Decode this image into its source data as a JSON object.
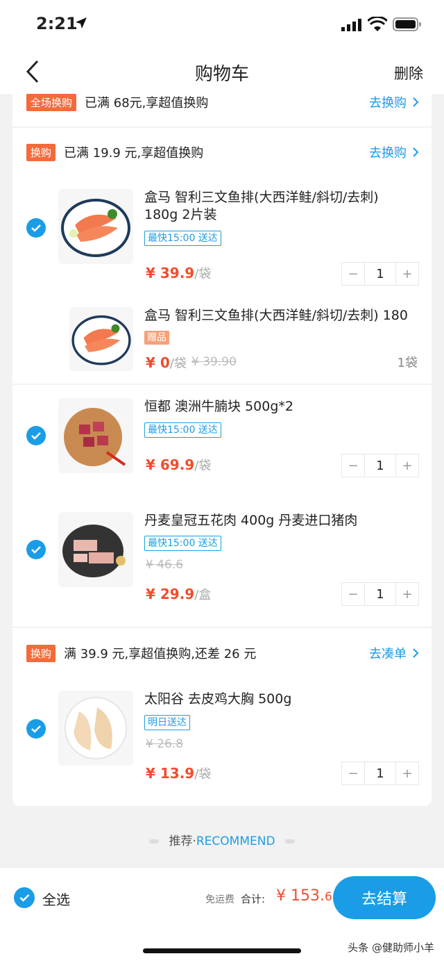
{
  "status": {
    "time": "2:21"
  },
  "nav": {
    "title": "购物车",
    "delete_label": "删除"
  },
  "promo_top": {
    "tag": "全场换购",
    "text": "已满 68元,享超值换购",
    "link": "去换购"
  },
  "group1": {
    "tag": "换购",
    "text": "已满 19.9 元,享超值换购",
    "link": "去换购"
  },
  "items": [
    {
      "name": "盒马 智利三文鱼排(大西洋鲑/斜切/去刺) 180g 2片装",
      "delivery": "最快15:00 送达",
      "price": "¥ 39.9",
      "unit": "/袋",
      "qty": "1"
    },
    {
      "name": "盒马 智利三文鱼排(大西洋鲑/斜切/去刺) 180",
      "gift": "赠品",
      "price": "¥ 0",
      "unit": "/袋",
      "old_price": "¥ 39.90",
      "qty_text": "1袋"
    },
    {
      "name": "恒都 澳洲牛腩块 500g*2",
      "delivery": "最快15:00 送达",
      "price": "¥ 69.9",
      "unit": "/袋",
      "qty": "1"
    },
    {
      "name": "丹麦皇冠五花肉 400g  丹麦进口猪肉",
      "delivery": "最快15:00 送达",
      "old_price": "¥ 46.6",
      "price": "¥ 29.9",
      "unit": "/盒",
      "qty": "1"
    },
    {
      "name": "太阳谷 去皮鸡大胸 500g",
      "delivery": "明日送达",
      "old_price": "¥ 26.8",
      "price": "¥ 13.9",
      "unit": "/袋",
      "qty": "1"
    }
  ],
  "group2": {
    "tag": "换购",
    "text": "满 39.9 元,享超值换购,还差 26 元",
    "link": "去凑单"
  },
  "recommend": {
    "cn": "推荐·",
    "en": "RECOMMEND"
  },
  "bottom": {
    "select_all": "全选",
    "free_shipping": "免运费",
    "total_label": "合计:",
    "total_main": "¥ 153.",
    "total_decimal": "6",
    "checkout": "去结算"
  },
  "watermark": "头条 @健助师小羊",
  "colors": {
    "accent": "#1a9de6",
    "price": "#f04d2e",
    "tag": "#f36b3b"
  }
}
